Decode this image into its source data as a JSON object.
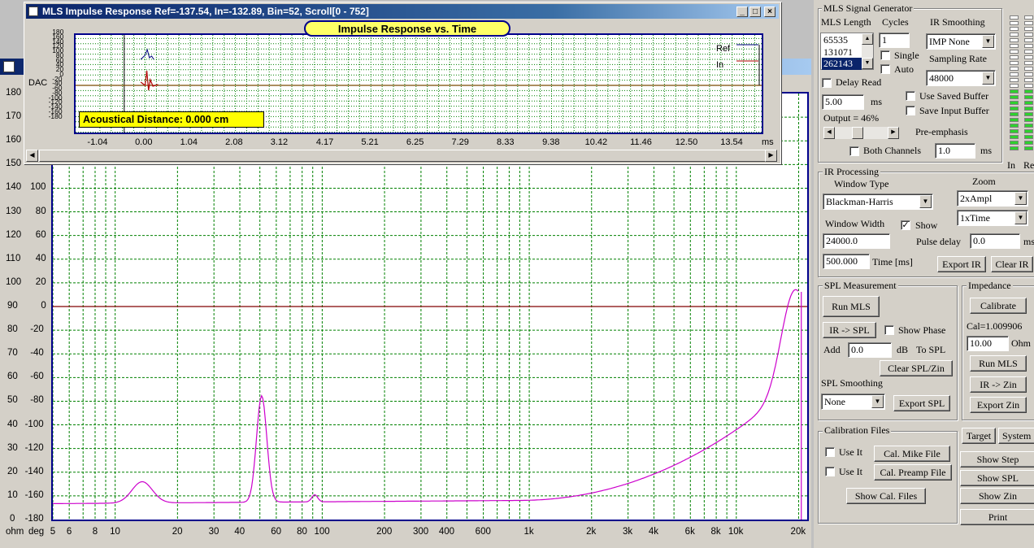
{
  "spl_window": {
    "left_axis_values": [
      "180",
      "170",
      "160",
      "150",
      "140",
      "130",
      "120",
      "110",
      "100",
      "90",
      "80",
      "70",
      "60",
      "50",
      "40",
      "30",
      "20",
      "10",
      "0"
    ],
    "right_axis_values": [
      "100",
      "80",
      "60",
      "40",
      "20",
      "0",
      "-20",
      "-40",
      "-60",
      "-80",
      "-100",
      "-120",
      "-140",
      "-160",
      "-180"
    ],
    "x_tick_labels": [
      "5",
      "6",
      "8",
      "10",
      "20",
      "30",
      "40",
      "60",
      "80",
      "100",
      "200",
      "300",
      "400",
      "600",
      "1k",
      "2k",
      "3k",
      "4k",
      "6k",
      "8k",
      "10k",
      "20k"
    ],
    "unit_ohm": "ohm",
    "unit_deg": "deg",
    "colors": {
      "grid": "#008000",
      "trace": "#cc00cc",
      "zero_line": "#800000",
      "border": "#00008b"
    }
  },
  "ir_window": {
    "title": "MLS Impulse Response  Ref=-137.54, In=-132.89, Bin=52, Scroll[0 - 752]",
    "heading": "Impulse Response vs. Time",
    "distance": "Acoustical Distance: 0.000 cm",
    "y_unit": "DAC",
    "y_ticks": [
      "180",
      "160",
      "140",
      "120",
      "100",
      "80",
      "60",
      "40",
      "20",
      "0",
      "-20",
      "-40",
      "-60",
      "-80",
      "-100",
      "-120",
      "-140",
      "-160",
      "-180"
    ],
    "x_ticks": [
      "-1.04",
      "0.00",
      "1.04",
      "2.08",
      "3.12",
      "4.17",
      "5.21",
      "6.25",
      "7.29",
      "8.33",
      "9.38",
      "10.42",
      "11.46",
      "12.50",
      "13.54"
    ],
    "x_unit": "ms",
    "legend": [
      "Ref",
      "In"
    ],
    "controls": {
      "minimize": "_",
      "maximize": "□",
      "close": "×"
    }
  },
  "generator": {
    "title": "MLS Signal Generator",
    "mls_length_label": "MLS Length",
    "mls_options": [
      "65535",
      "131071",
      "262143"
    ],
    "cycles_label": "Cycles",
    "cycles_value": "1",
    "single_label": "Single",
    "auto_label": "Auto",
    "ir_smoothing_label": "IR Smoothing",
    "ir_smoothing_value": "IMP None",
    "sampling_rate_label": "Sampling Rate",
    "sampling_rate_value": "48000",
    "delay_read_label": "Delay Read",
    "delay_value": "5.00",
    "ms": "ms",
    "use_saved_buffer": "Use Saved Buffer",
    "save_input_buffer": "Save Input Buffer",
    "output_label": "Output = 46%",
    "pre_emphasis": "Pre-emphasis",
    "both_channels": "Both Channels",
    "pre_emphasis_value": "1.0"
  },
  "ir_processing": {
    "title": "IR Processing",
    "window_type_label": "Window Type",
    "window_type_value": "Blackman-Harris",
    "zoom_label": "Zoom",
    "zoom_ampl": "2xAmpl",
    "zoom_time": "1xTime",
    "window_width_label": "Window Width",
    "show_label": "Show",
    "window_width_value": "24000.0",
    "pulse_delay_label": "Pulse delay",
    "pulse_delay_value": "0.0",
    "pulse_delay_unit": "ms",
    "time_value": "500.000",
    "time_label": "Time [ms]",
    "export_ir": "Export IR",
    "clear_ir": "Clear IR"
  },
  "spl": {
    "title": "SPL Measurement",
    "run_mls": "Run MLS",
    "ir_to_spl": "IR -> SPL",
    "show_phase": "Show Phase",
    "add_label": "Add",
    "add_value": "0.0",
    "db_label": "dB",
    "to_spl": "To SPL",
    "clear_spl": "Clear SPL/Zin",
    "smoothing_label": "SPL Smoothing",
    "smoothing_value": "None",
    "export_spl": "Export SPL"
  },
  "impedance": {
    "title": "Impedance",
    "calibrate": "Calibrate",
    "cal_value": "Cal=1.009906",
    "ohm_value": "10.00",
    "ohm_label": "Ohm",
    "run_mls": "Run MLS",
    "ir_to_zin": "IR -> Zin",
    "export_zin": "Export Zin"
  },
  "calibration": {
    "title": "Calibration Files",
    "use_it": "Use It",
    "cal_mike": "Cal. Mike File",
    "cal_preamp": "Cal. Preamp File",
    "show_cal": "Show Cal. Files"
  },
  "bottom_buttons": {
    "target": "Target",
    "system": "System",
    "show_step": "Show Step",
    "show_spl": "Show SPL",
    "show_zin": "Show Zin",
    "print": "Print"
  },
  "meters": {
    "in_label": "In",
    "ref_label": "Re",
    "in_level": 0.45,
    "ref_level": 0.45
  }
}
